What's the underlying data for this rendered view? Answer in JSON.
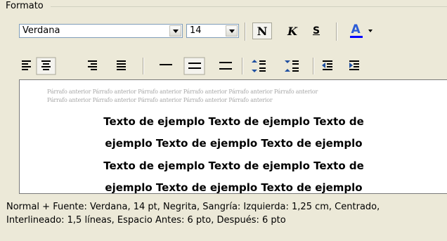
{
  "group": {
    "title": "Formato"
  },
  "font": {
    "name": "Verdana",
    "size": "14"
  },
  "style_buttons": {
    "bold": "N",
    "italic": "K",
    "underline": "S",
    "font_color": "A"
  },
  "colors": {
    "font_color_bar": "#0000ff",
    "font_color_letter": "#2a5bd7"
  },
  "preview": {
    "prev_line_1": "Párrafo anterior Párrafo anterior Párrafo anterior Párrafo anterior Párrafo anterior Párrafo anterior",
    "prev_line_2": "Párrafo anterior Párrafo anterior Párrafo anterior Párrafo anterior Párrafo anterior",
    "sample_lines": [
      "Texto de ejemplo Texto de ejemplo Texto de",
      "ejemplo Texto de ejemplo Texto de ejemplo",
      "Texto de ejemplo Texto de ejemplo Texto de",
      "ejemplo Texto de ejemplo Texto de ejemplo"
    ]
  },
  "description": {
    "line1": "Normal + Fuente: Verdana, 14 pt, Negrita, Sangría: Izquierda:  1,25 cm, Centrado,",
    "line2": "Interlineado:  1,5 líneas, Espacio Antes:  6 pto, Después:  6 pto"
  }
}
